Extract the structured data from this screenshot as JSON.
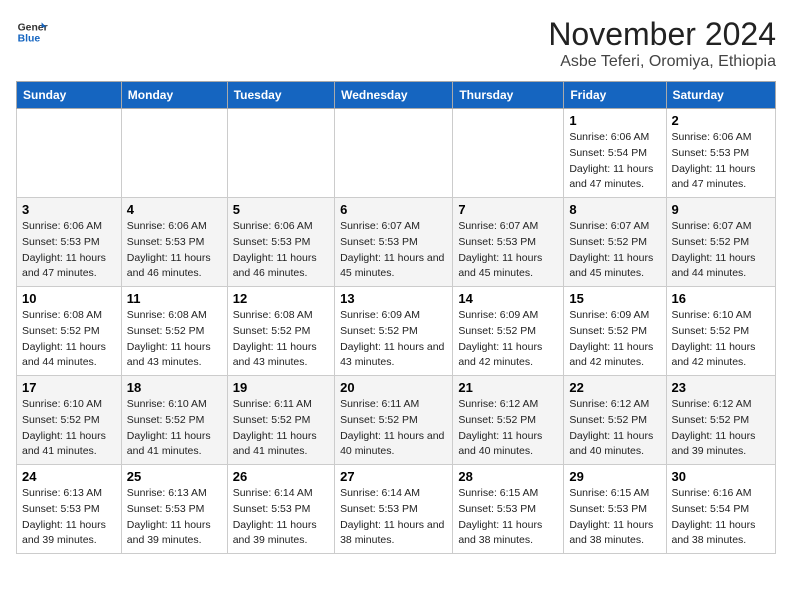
{
  "header": {
    "logo_line1": "General",
    "logo_line2": "Blue",
    "title": "November 2024",
    "subtitle": "Asbe Teferi, Oromiya, Ethiopia"
  },
  "days_of_week": [
    "Sunday",
    "Monday",
    "Tuesday",
    "Wednesday",
    "Thursday",
    "Friday",
    "Saturday"
  ],
  "weeks": [
    [
      {
        "day": "",
        "info": ""
      },
      {
        "day": "",
        "info": ""
      },
      {
        "day": "",
        "info": ""
      },
      {
        "day": "",
        "info": ""
      },
      {
        "day": "",
        "info": ""
      },
      {
        "day": "1",
        "info": "Sunrise: 6:06 AM\nSunset: 5:54 PM\nDaylight: 11 hours and 47 minutes."
      },
      {
        "day": "2",
        "info": "Sunrise: 6:06 AM\nSunset: 5:53 PM\nDaylight: 11 hours and 47 minutes."
      }
    ],
    [
      {
        "day": "3",
        "info": "Sunrise: 6:06 AM\nSunset: 5:53 PM\nDaylight: 11 hours and 47 minutes."
      },
      {
        "day": "4",
        "info": "Sunrise: 6:06 AM\nSunset: 5:53 PM\nDaylight: 11 hours and 46 minutes."
      },
      {
        "day": "5",
        "info": "Sunrise: 6:06 AM\nSunset: 5:53 PM\nDaylight: 11 hours and 46 minutes."
      },
      {
        "day": "6",
        "info": "Sunrise: 6:07 AM\nSunset: 5:53 PM\nDaylight: 11 hours and 45 minutes."
      },
      {
        "day": "7",
        "info": "Sunrise: 6:07 AM\nSunset: 5:53 PM\nDaylight: 11 hours and 45 minutes."
      },
      {
        "day": "8",
        "info": "Sunrise: 6:07 AM\nSunset: 5:52 PM\nDaylight: 11 hours and 45 minutes."
      },
      {
        "day": "9",
        "info": "Sunrise: 6:07 AM\nSunset: 5:52 PM\nDaylight: 11 hours and 44 minutes."
      }
    ],
    [
      {
        "day": "10",
        "info": "Sunrise: 6:08 AM\nSunset: 5:52 PM\nDaylight: 11 hours and 44 minutes."
      },
      {
        "day": "11",
        "info": "Sunrise: 6:08 AM\nSunset: 5:52 PM\nDaylight: 11 hours and 43 minutes."
      },
      {
        "day": "12",
        "info": "Sunrise: 6:08 AM\nSunset: 5:52 PM\nDaylight: 11 hours and 43 minutes."
      },
      {
        "day": "13",
        "info": "Sunrise: 6:09 AM\nSunset: 5:52 PM\nDaylight: 11 hours and 43 minutes."
      },
      {
        "day": "14",
        "info": "Sunrise: 6:09 AM\nSunset: 5:52 PM\nDaylight: 11 hours and 42 minutes."
      },
      {
        "day": "15",
        "info": "Sunrise: 6:09 AM\nSunset: 5:52 PM\nDaylight: 11 hours and 42 minutes."
      },
      {
        "day": "16",
        "info": "Sunrise: 6:10 AM\nSunset: 5:52 PM\nDaylight: 11 hours and 42 minutes."
      }
    ],
    [
      {
        "day": "17",
        "info": "Sunrise: 6:10 AM\nSunset: 5:52 PM\nDaylight: 11 hours and 41 minutes."
      },
      {
        "day": "18",
        "info": "Sunrise: 6:10 AM\nSunset: 5:52 PM\nDaylight: 11 hours and 41 minutes."
      },
      {
        "day": "19",
        "info": "Sunrise: 6:11 AM\nSunset: 5:52 PM\nDaylight: 11 hours and 41 minutes."
      },
      {
        "day": "20",
        "info": "Sunrise: 6:11 AM\nSunset: 5:52 PM\nDaylight: 11 hours and 40 minutes."
      },
      {
        "day": "21",
        "info": "Sunrise: 6:12 AM\nSunset: 5:52 PM\nDaylight: 11 hours and 40 minutes."
      },
      {
        "day": "22",
        "info": "Sunrise: 6:12 AM\nSunset: 5:52 PM\nDaylight: 11 hours and 40 minutes."
      },
      {
        "day": "23",
        "info": "Sunrise: 6:12 AM\nSunset: 5:52 PM\nDaylight: 11 hours and 39 minutes."
      }
    ],
    [
      {
        "day": "24",
        "info": "Sunrise: 6:13 AM\nSunset: 5:53 PM\nDaylight: 11 hours and 39 minutes."
      },
      {
        "day": "25",
        "info": "Sunrise: 6:13 AM\nSunset: 5:53 PM\nDaylight: 11 hours and 39 minutes."
      },
      {
        "day": "26",
        "info": "Sunrise: 6:14 AM\nSunset: 5:53 PM\nDaylight: 11 hours and 39 minutes."
      },
      {
        "day": "27",
        "info": "Sunrise: 6:14 AM\nSunset: 5:53 PM\nDaylight: 11 hours and 38 minutes."
      },
      {
        "day": "28",
        "info": "Sunrise: 6:15 AM\nSunset: 5:53 PM\nDaylight: 11 hours and 38 minutes."
      },
      {
        "day": "29",
        "info": "Sunrise: 6:15 AM\nSunset: 5:53 PM\nDaylight: 11 hours and 38 minutes."
      },
      {
        "day": "30",
        "info": "Sunrise: 6:16 AM\nSunset: 5:54 PM\nDaylight: 11 hours and 38 minutes."
      }
    ]
  ]
}
